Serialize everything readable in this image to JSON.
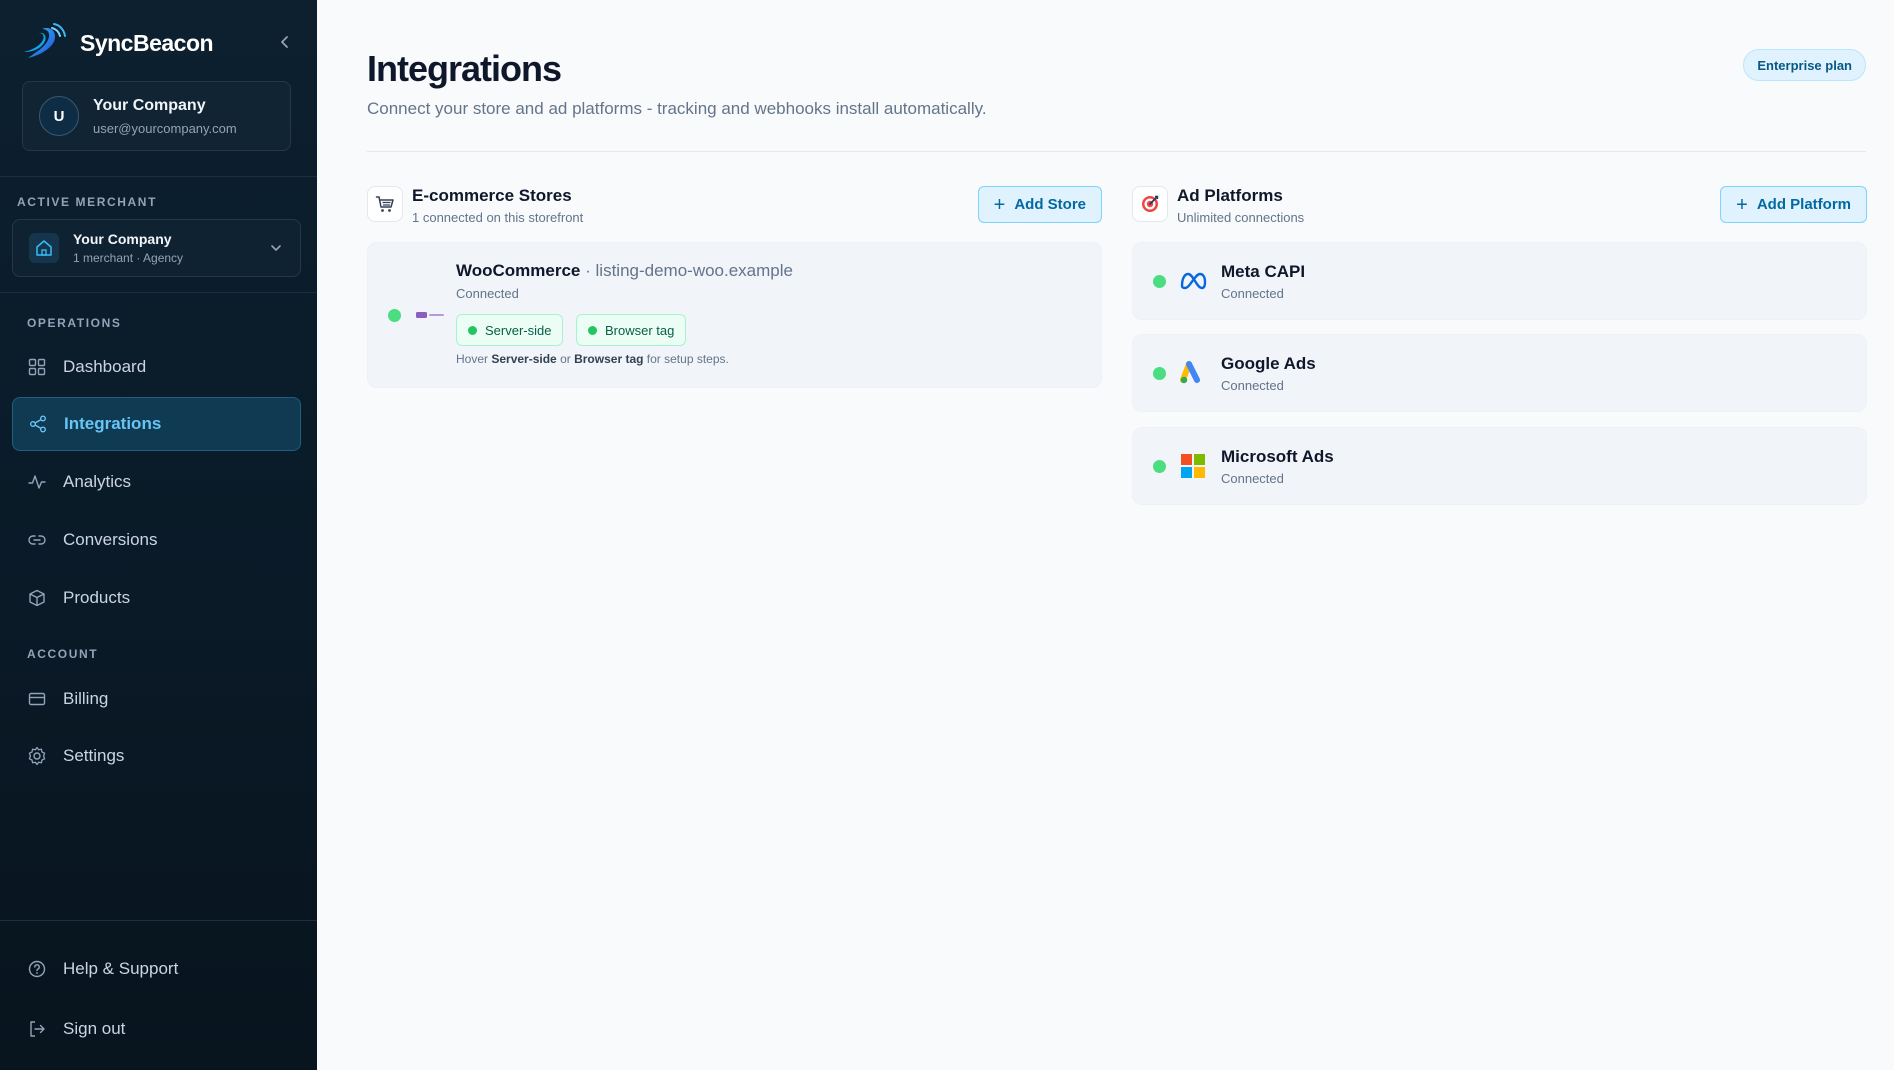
{
  "brand": {
    "name": "SyncBeacon"
  },
  "user": {
    "initial": "U",
    "name": "Your Company",
    "email": "user@yourcompany.com"
  },
  "merchant": {
    "section_label": "ACTIVE MERCHANT",
    "name": "Your Company",
    "sub": "1 merchant · Agency"
  },
  "nav": {
    "operations_label": "OPERATIONS",
    "account_label": "ACCOUNT",
    "dashboard": "Dashboard",
    "integrations": "Integrations",
    "analytics": "Analytics",
    "conversions": "Conversions",
    "products": "Products",
    "billing": "Billing",
    "settings": "Settings",
    "help": "Help & Support",
    "signout": "Sign out"
  },
  "page": {
    "title": "Integrations",
    "subtitle": "Connect your store and ad platforms - tracking and webhooks install automatically.",
    "plan_badge": "Enterprise plan"
  },
  "stores": {
    "title": "E-commerce Stores",
    "subtitle": "1 connected on this storefront",
    "add_label": "Add Store",
    "items": [
      {
        "name": "WooCommerce",
        "domain": "· listing-demo-woo.example",
        "status": "Connected",
        "pill_server": "Server-side",
        "pill_browser": "Browser tag",
        "hint_prefix": "Hover",
        "hint_server": "Server-side",
        "hint_or": "or",
        "hint_browser": "Browser tag",
        "hint_suffix": "for setup steps."
      }
    ]
  },
  "platforms": {
    "title": "Ad Platforms",
    "subtitle": "Unlimited connections",
    "add_label": "Add Platform",
    "items": [
      {
        "name": "Meta CAPI",
        "status": "Connected"
      },
      {
        "name": "Google Ads",
        "status": "Connected"
      },
      {
        "name": "Microsoft Ads",
        "status": "Connected"
      }
    ]
  },
  "colors": {
    "accent": "#0369a1",
    "active_nav": "#67c5f5",
    "connected": "#4ade80",
    "sidebar_bg": "#0a1a27"
  }
}
